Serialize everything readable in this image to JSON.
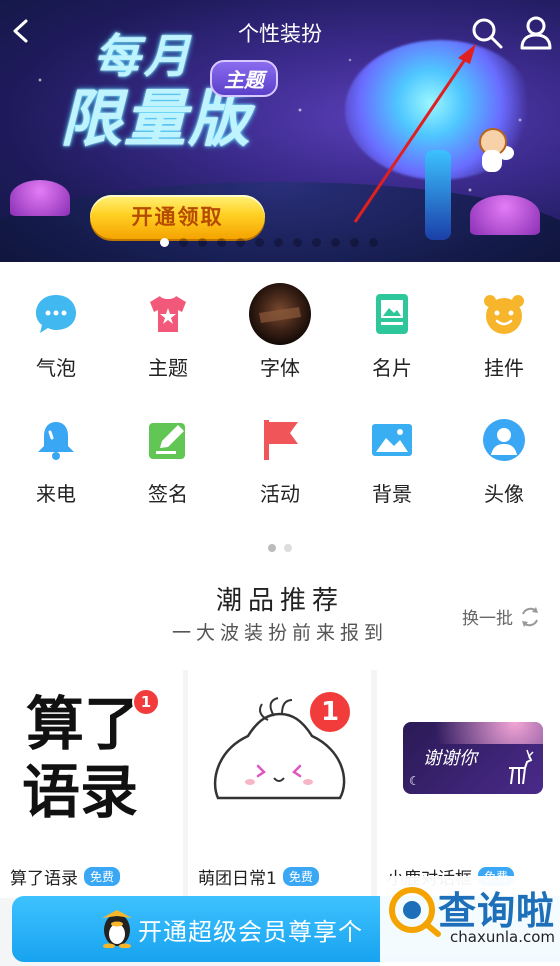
{
  "header": {
    "title": "个性装扮"
  },
  "banner": {
    "title_line1": "每月",
    "title_line2": "限量版",
    "badge": "主题",
    "cta": "开通领取",
    "page_count": 12,
    "active_index": 0
  },
  "categories": [
    {
      "label": "气泡",
      "icon": "bubble-icon",
      "color": "#42b8f0"
    },
    {
      "label": "主题",
      "icon": "theme-shirt-icon",
      "color": "#f2587a"
    },
    {
      "label": "字体",
      "icon": "font-photo-icon",
      "color": "#4a2a1a"
    },
    {
      "label": "名片",
      "icon": "card-icon",
      "color": "#2ec79c"
    },
    {
      "label": "挂件",
      "icon": "pendant-bear-icon",
      "color": "#f7b52c"
    },
    {
      "label": "来电",
      "icon": "bell-icon",
      "color": "#3aa7f4"
    },
    {
      "label": "签名",
      "icon": "signature-edit-icon",
      "color": "#62c655"
    },
    {
      "label": "活动",
      "icon": "flag-icon",
      "color": "#f0555a"
    },
    {
      "label": "背景",
      "icon": "image-icon",
      "color": "#3aaef2"
    },
    {
      "label": "头像",
      "icon": "avatar-icon",
      "color": "#3aa7f4"
    }
  ],
  "recommend": {
    "title": "潮品推荐",
    "subtitle": "一大波装扮前来报到",
    "refresh": "换一批",
    "items": [
      {
        "name": "算了语录",
        "tag": "免费",
        "thumb_l1": "算了",
        "thumb_l2": "语录",
        "badge": "1"
      },
      {
        "name": "萌团日常1",
        "tag": "免费",
        "badge": "1"
      },
      {
        "name": "小鹿对话框",
        "tag": "免费",
        "thumb_text": "谢谢你"
      }
    ]
  },
  "vip": {
    "label": "开通超级会员尊享个"
  },
  "watermark": {
    "text": "查询啦",
    "url": "chaxunla.com"
  }
}
